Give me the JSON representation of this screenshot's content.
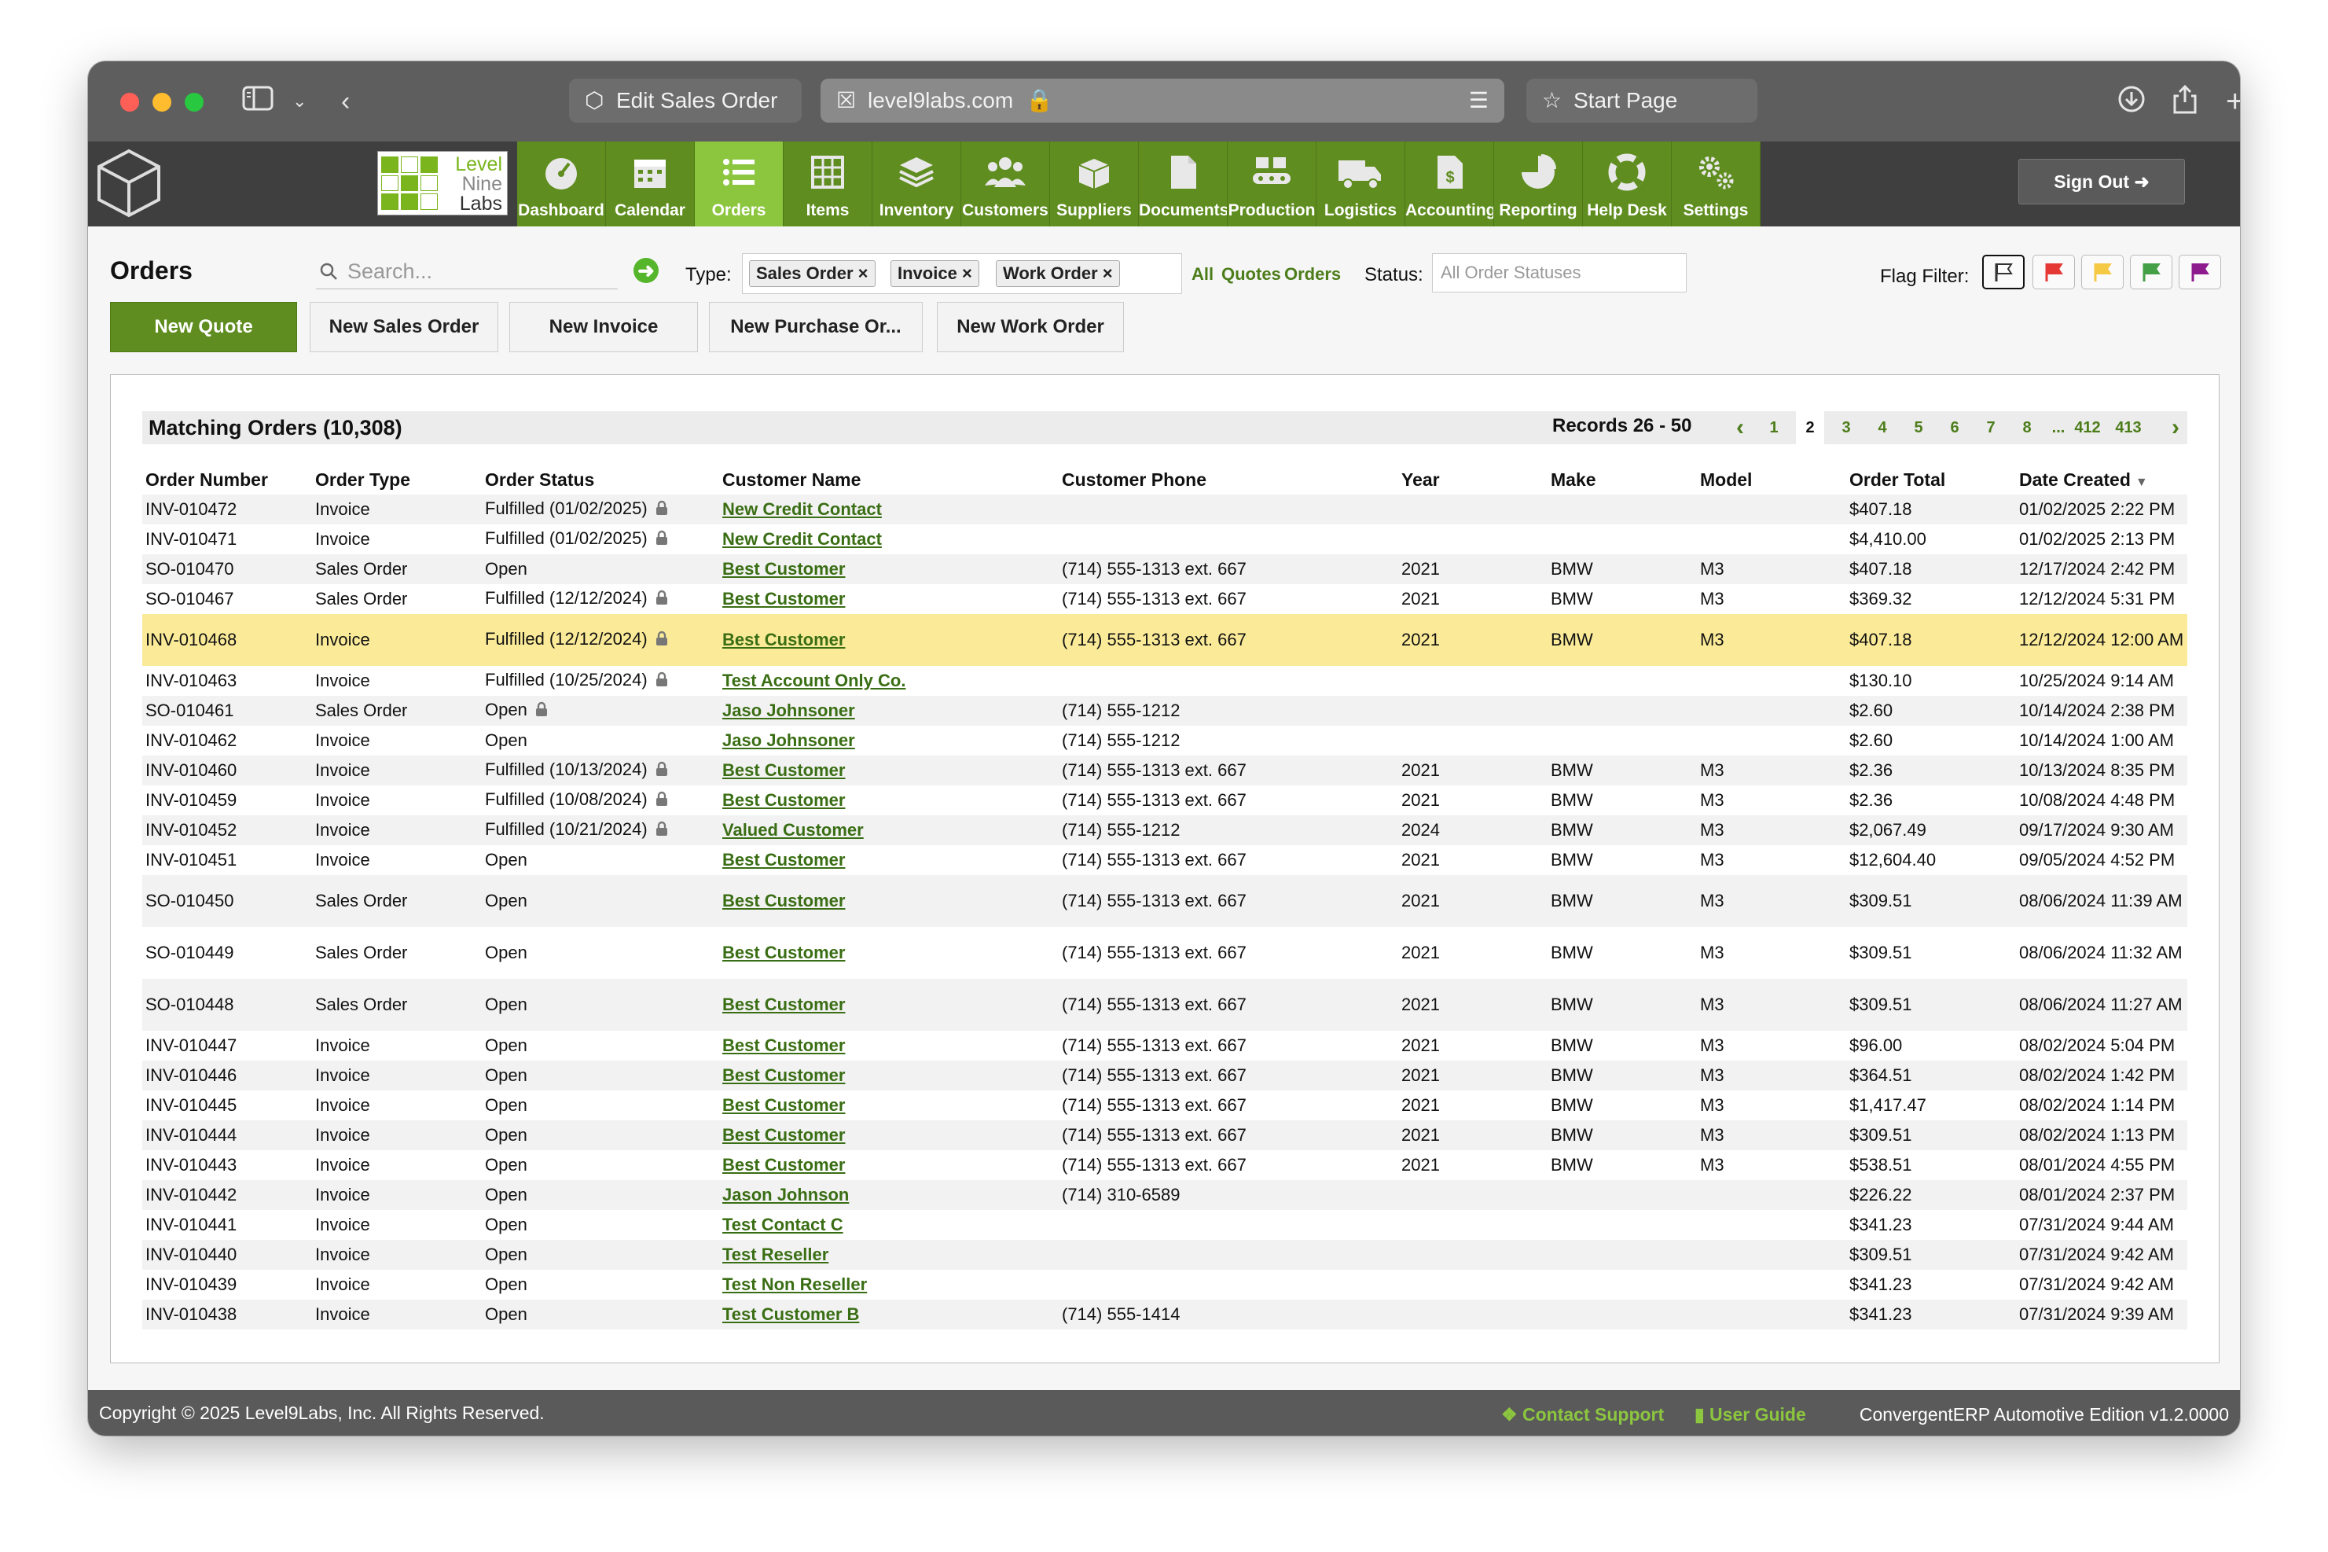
{
  "browser": {
    "tab1": "Edit Sales Order",
    "address": "level9labs.com",
    "tab3": "Start Page"
  },
  "app": {
    "logo_lines": [
      "Level",
      "Nine",
      "Labs"
    ],
    "nav": [
      "Dashboard",
      "Calendar",
      "Orders",
      "Items",
      "Inventory",
      "Customers",
      "Suppliers",
      "Documents",
      "Production",
      "Logistics",
      "Accounting",
      "Reporting",
      "Help Desk",
      "Settings"
    ],
    "active_nav": "Orders",
    "sign_out": "Sign Out"
  },
  "toolbar": {
    "title": "Orders",
    "search_placeholder": "Search...",
    "type_label": "Type:",
    "type_chips": [
      "Sales Order",
      "Invoice",
      "Work Order"
    ],
    "type_links": [
      "All",
      "Quotes",
      "Orders"
    ],
    "status_label": "Status:",
    "status_placeholder": "All Order Statuses",
    "flag_label": "Flag Filter:",
    "flag_colors": [
      "#ffffff",
      "#e53935",
      "#f6c945",
      "#43a047",
      "#8e1b8e"
    ]
  },
  "actions": [
    "New Quote",
    "New Sales Order",
    "New Invoice",
    "New Purchase Or...",
    "New Work Order"
  ],
  "panel": {
    "matching": "Matching Orders (10,308)",
    "records": "Records 26 - 50",
    "pages": [
      "1",
      "2",
      "3",
      "4",
      "5",
      "6",
      "7",
      "8",
      "...",
      "412",
      "413"
    ],
    "current_page": "2"
  },
  "table": {
    "headers": [
      "Order Number",
      "Order Type",
      "Order Status",
      "Customer Name",
      "Customer Phone",
      "Year",
      "Make",
      "Model",
      "Order Total",
      "Date Created"
    ],
    "rows": [
      {
        "num": "INV-010472",
        "type": "Invoice",
        "status": "Fulfilled (01/02/2025)",
        "lock": true,
        "customer": "New Credit Contact",
        "phone": "",
        "year": "",
        "make": "",
        "model": "",
        "total": "$407.18",
        "date": "01/02/2025 2:22 PM"
      },
      {
        "num": "INV-010471",
        "type": "Invoice",
        "status": "Fulfilled (01/02/2025)",
        "lock": true,
        "customer": "New Credit Contact",
        "phone": "",
        "year": "",
        "make": "",
        "model": "",
        "total": "$4,410.00",
        "date": "01/02/2025 2:13 PM"
      },
      {
        "num": "SO-010470",
        "type": "Sales Order",
        "status": "Open",
        "lock": false,
        "customer": "Best Customer",
        "phone": "(714) 555-1313 ext. 667",
        "year": "2021",
        "make": "BMW",
        "model": "M3",
        "total": "$407.18",
        "date": "12/17/2024 2:42 PM"
      },
      {
        "num": "SO-010467",
        "type": "Sales Order",
        "status": "Fulfilled (12/12/2024)",
        "lock": true,
        "customer": "Best Customer",
        "phone": "(714) 555-1313 ext. 667",
        "year": "2021",
        "make": "BMW",
        "model": "M3",
        "total": "$369.32",
        "date": "12/12/2024 5:31 PM"
      },
      {
        "num": "INV-010468",
        "type": "Invoice",
        "status": "Fulfilled (12/12/2024)",
        "lock": true,
        "customer": "Best Customer",
        "phone": "(714) 555-1313 ext. 667",
        "year": "2021",
        "make": "BMW",
        "model": "M3",
        "total": "$407.18",
        "date": "12/12/2024 12:00 AM",
        "tall": true,
        "highlight": true
      },
      {
        "num": "INV-010463",
        "type": "Invoice",
        "status": "Fulfilled (10/25/2024)",
        "lock": true,
        "customer": "Test Account Only Co.",
        "phone": "",
        "year": "",
        "make": "",
        "model": "",
        "total": "$130.10",
        "date": "10/25/2024 9:14 AM"
      },
      {
        "num": "SO-010461",
        "type": "Sales Order",
        "status": "Open",
        "lock": true,
        "customer": "Jaso Johnsoner",
        "phone": "(714) 555-1212",
        "year": "",
        "make": "",
        "model": "",
        "total": "$2.60",
        "date": "10/14/2024 2:38 PM"
      },
      {
        "num": "INV-010462",
        "type": "Invoice",
        "status": "Open",
        "lock": false,
        "customer": "Jaso Johnsoner",
        "phone": "(714) 555-1212",
        "year": "",
        "make": "",
        "model": "",
        "total": "$2.60",
        "date": "10/14/2024 1:00 AM"
      },
      {
        "num": "INV-010460",
        "type": "Invoice",
        "status": "Fulfilled (10/13/2024)",
        "lock": true,
        "customer": "Best Customer",
        "phone": "(714) 555-1313 ext. 667",
        "year": "2021",
        "make": "BMW",
        "model": "M3",
        "total": "$2.36",
        "date": "10/13/2024 8:35 PM"
      },
      {
        "num": "INV-010459",
        "type": "Invoice",
        "status": "Fulfilled (10/08/2024)",
        "lock": true,
        "customer": "Best Customer",
        "phone": "(714) 555-1313 ext. 667",
        "year": "2021",
        "make": "BMW",
        "model": "M3",
        "total": "$2.36",
        "date": "10/08/2024 4:48 PM"
      },
      {
        "num": "INV-010452",
        "type": "Invoice",
        "status": "Fulfilled (10/21/2024)",
        "lock": true,
        "customer": "Valued Customer",
        "phone": "(714) 555-1212",
        "year": "2024",
        "make": "BMW",
        "model": "M3",
        "total": "$2,067.49",
        "date": "09/17/2024 9:30 AM"
      },
      {
        "num": "INV-010451",
        "type": "Invoice",
        "status": "Open",
        "lock": false,
        "customer": "Best Customer",
        "phone": "(714) 555-1313 ext. 667",
        "year": "2021",
        "make": "BMW",
        "model": "M3",
        "total": "$12,604.40",
        "date": "09/05/2024 4:52 PM"
      },
      {
        "num": "SO-010450",
        "type": "Sales Order",
        "status": "Open",
        "lock": false,
        "customer": "Best Customer",
        "phone": "(714) 555-1313 ext. 667",
        "year": "2021",
        "make": "BMW",
        "model": "M3",
        "total": "$309.51",
        "date": "08/06/2024 11:39 AM",
        "tall": true
      },
      {
        "num": "SO-010449",
        "type": "Sales Order",
        "status": "Open",
        "lock": false,
        "customer": "Best Customer",
        "phone": "(714) 555-1313 ext. 667",
        "year": "2021",
        "make": "BMW",
        "model": "M3",
        "total": "$309.51",
        "date": "08/06/2024 11:32 AM",
        "tall": true
      },
      {
        "num": "SO-010448",
        "type": "Sales Order",
        "status": "Open",
        "lock": false,
        "customer": "Best Customer",
        "phone": "(714) 555-1313 ext. 667",
        "year": "2021",
        "make": "BMW",
        "model": "M3",
        "total": "$309.51",
        "date": "08/06/2024 11:27 AM",
        "tall": true
      },
      {
        "num": "INV-010447",
        "type": "Invoice",
        "status": "Open",
        "lock": false,
        "customer": "Best Customer",
        "phone": "(714) 555-1313 ext. 667",
        "year": "2021",
        "make": "BMW",
        "model": "M3",
        "total": "$96.00",
        "date": "08/02/2024 5:04 PM"
      },
      {
        "num": "INV-010446",
        "type": "Invoice",
        "status": "Open",
        "lock": false,
        "customer": "Best Customer",
        "phone": "(714) 555-1313 ext. 667",
        "year": "2021",
        "make": "BMW",
        "model": "M3",
        "total": "$364.51",
        "date": "08/02/2024 1:42 PM"
      },
      {
        "num": "INV-010445",
        "type": "Invoice",
        "status": "Open",
        "lock": false,
        "customer": "Best Customer",
        "phone": "(714) 555-1313 ext. 667",
        "year": "2021",
        "make": "BMW",
        "model": "M3",
        "total": "$1,417.47",
        "date": "08/02/2024 1:14 PM"
      },
      {
        "num": "INV-010444",
        "type": "Invoice",
        "status": "Open",
        "lock": false,
        "customer": "Best Customer",
        "phone": "(714) 555-1313 ext. 667",
        "year": "2021",
        "make": "BMW",
        "model": "M3",
        "total": "$309.51",
        "date": "08/02/2024 1:13 PM"
      },
      {
        "num": "INV-010443",
        "type": "Invoice",
        "status": "Open",
        "lock": false,
        "customer": "Best Customer",
        "phone": "(714) 555-1313 ext. 667",
        "year": "2021",
        "make": "BMW",
        "model": "M3",
        "total": "$538.51",
        "date": "08/01/2024 4:55 PM"
      },
      {
        "num": "INV-010442",
        "type": "Invoice",
        "status": "Open",
        "lock": false,
        "customer": "Jason Johnson",
        "phone": "(714) 310-6589",
        "year": "",
        "make": "",
        "model": "",
        "total": "$226.22",
        "date": "08/01/2024 2:37 PM"
      },
      {
        "num": "INV-010441",
        "type": "Invoice",
        "status": "Open",
        "lock": false,
        "customer": "Test Contact C",
        "phone": "",
        "year": "",
        "make": "",
        "model": "",
        "total": "$341.23",
        "date": "07/31/2024 9:44 AM"
      },
      {
        "num": "INV-010440",
        "type": "Invoice",
        "status": "Open",
        "lock": false,
        "customer": "Test Reseller",
        "phone": "",
        "year": "",
        "make": "",
        "model": "",
        "total": "$309.51",
        "date": "07/31/2024 9:42 AM"
      },
      {
        "num": "INV-010439",
        "type": "Invoice",
        "status": "Open",
        "lock": false,
        "customer": "Test Non Reseller",
        "phone": "",
        "year": "",
        "make": "",
        "model": "",
        "total": "$341.23",
        "date": "07/31/2024 9:42 AM"
      },
      {
        "num": "INV-010438",
        "type": "Invoice",
        "status": "Open",
        "lock": false,
        "customer": "Test Customer B",
        "phone": "(714) 555-1414",
        "year": "",
        "make": "",
        "model": "",
        "total": "$341.23",
        "date": "07/31/2024 9:39 AM"
      }
    ]
  },
  "footer": {
    "copyright": "Copyright © 2025 Level9Labs, Inc. All Rights Reserved.",
    "contact": "Contact Support",
    "guide": "User Guide",
    "version": "ConvergentERP Automotive Edition v1.2.0000"
  }
}
